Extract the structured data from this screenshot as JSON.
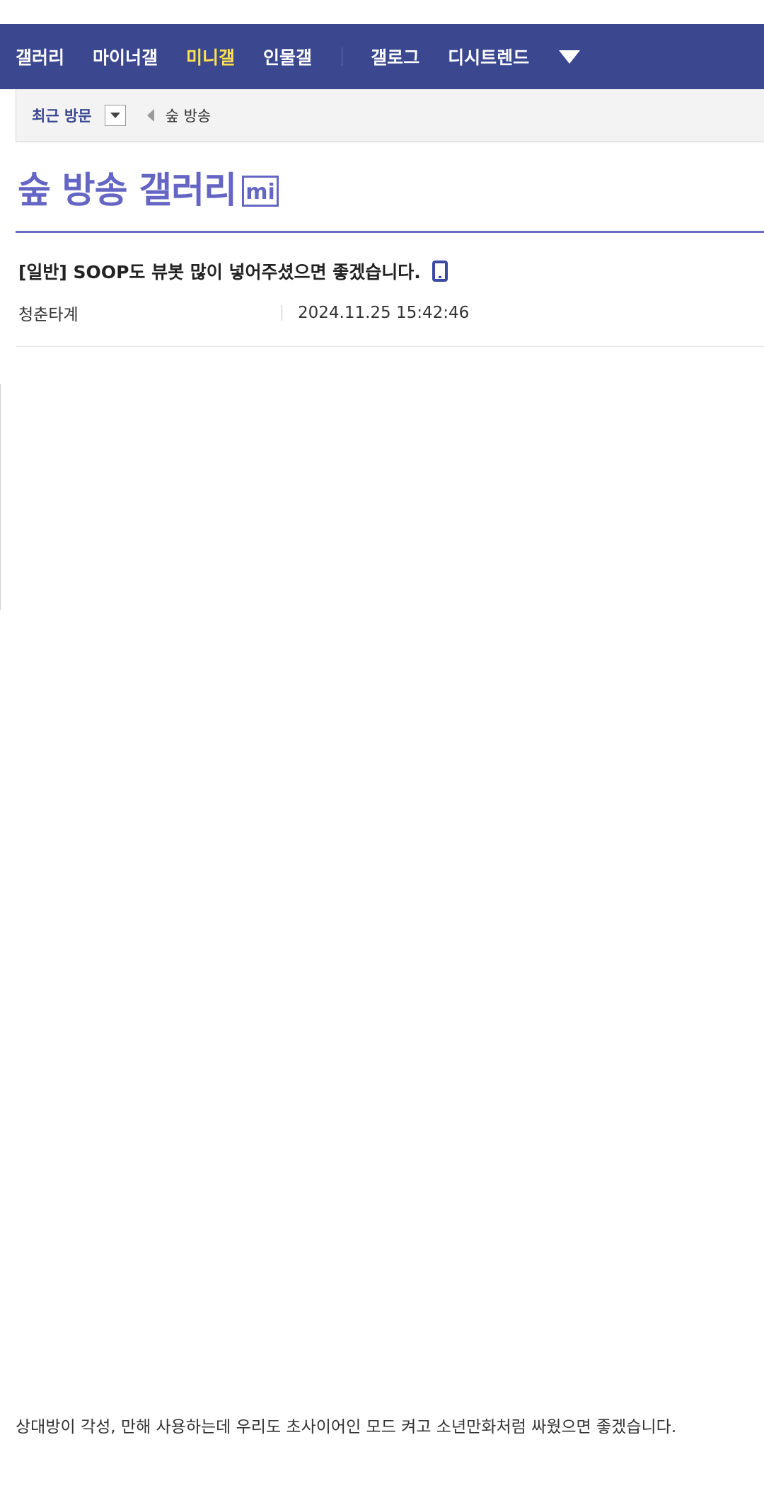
{
  "nav": {
    "items": [
      "갤러리",
      "마이너갤",
      "미니갤",
      "인물갤"
    ],
    "items_right": [
      "갤로그",
      "디시트렌드"
    ],
    "active_color": "#ffe14e",
    "background": "#3b4890",
    "more_icon": "triangle-down-icon"
  },
  "recent": {
    "label": "최근 방문",
    "item": "숲 방송"
  },
  "gallery": {
    "title": "숲 방송 갤러리",
    "badge": "mi",
    "accent": "#6566c4"
  },
  "post": {
    "title": "[일반] SOOP도 뷰봇 많이 넣어주셨으면 좋겠습니다.",
    "device_icon": "mobile-icon",
    "author": "청춘타계",
    "date": "2024.11.25 15:42:46",
    "body": "상대방이 각성, 만해 사용하는데 우리도 초사이어인 모드 켜고 소년만화처럼 싸웠으면 좋겠습니다."
  }
}
